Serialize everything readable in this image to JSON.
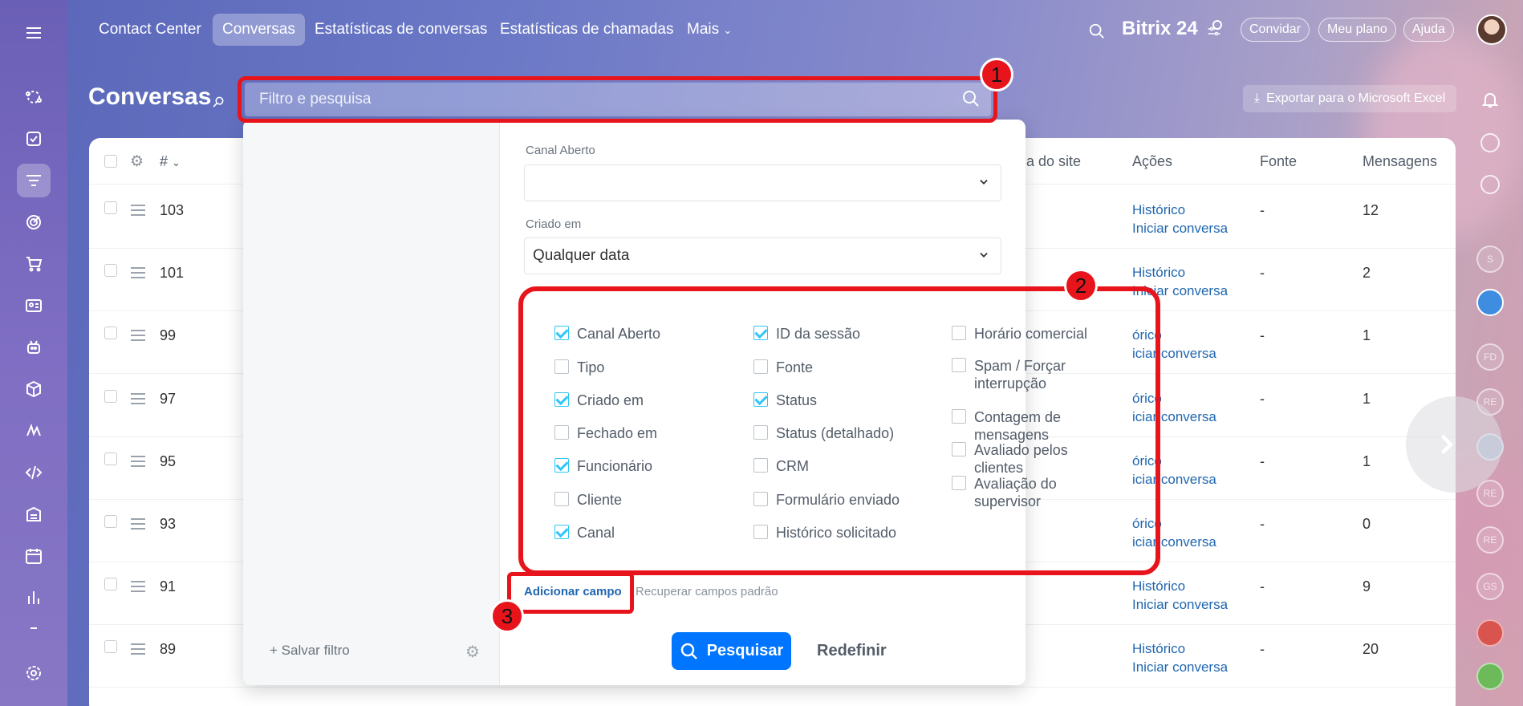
{
  "topbar": {
    "tabs": [
      "Contact Center",
      "Conversas",
      "Estatísticas de conversas",
      "Estatísticas de chamadas",
      "Mais"
    ],
    "brand": "Bitrix 24",
    "invite": "Convidar",
    "plan": "Meu plano",
    "help": "Ajuda"
  },
  "page": {
    "title": "Conversas",
    "export_label": "Exportar para o Microsoft Excel"
  },
  "search": {
    "placeholder": "Filtro e pesquisa"
  },
  "table": {
    "columns": [
      "#",
      "a do site",
      "Ações",
      "Fonte",
      "Mensagens"
    ],
    "rows": [
      {
        "id": "103",
        "actions": [
          "Histórico",
          "Iniciar conversa"
        ],
        "source": "-",
        "messages": "12"
      },
      {
        "id": "101",
        "actions": [
          "Histórico",
          "Iniciar conversa"
        ],
        "source": "-",
        "messages": "2"
      },
      {
        "id": "99",
        "actions": [
          "órico",
          "iciar conversa"
        ],
        "source": "-",
        "messages": "1"
      },
      {
        "id": "97",
        "actions": [
          "órico",
          "iciar conversa"
        ],
        "source": "-",
        "messages": "1"
      },
      {
        "id": "95",
        "actions": [
          "órico",
          "iciar conversa"
        ],
        "source": "-",
        "messages": "1"
      },
      {
        "id": "93",
        "actions": [
          "órico",
          "iciar conversa"
        ],
        "source": "-",
        "messages": "0"
      },
      {
        "id": "91",
        "actions": [
          "Histórico",
          "Iniciar conversa"
        ],
        "source": "-",
        "messages": "9"
      },
      {
        "id": "89",
        "actions": [
          "Histórico",
          "Iniciar conversa"
        ],
        "source": "-",
        "messages": "20"
      }
    ]
  },
  "filter": {
    "channel_label": "Canal Aberto",
    "channel_value": "",
    "created_label": "Criado em",
    "created_value": "Qualquer data",
    "fields_col1": [
      {
        "label": "Canal Aberto",
        "checked": true
      },
      {
        "label": "Tipo",
        "checked": false
      },
      {
        "label": "Criado em",
        "checked": true
      },
      {
        "label": "Fechado em",
        "checked": false
      },
      {
        "label": "Funcionário",
        "checked": true
      },
      {
        "label": "Cliente",
        "checked": false
      },
      {
        "label": "Canal",
        "checked": true
      }
    ],
    "fields_col2": [
      {
        "label": "ID da sessão",
        "checked": true
      },
      {
        "label": "Fonte",
        "checked": false
      },
      {
        "label": "Status",
        "checked": true
      },
      {
        "label": "Status (detalhado)",
        "checked": false
      },
      {
        "label": "CRM",
        "checked": false
      },
      {
        "label": "Formulário enviado",
        "checked": false
      },
      {
        "label": "Histórico solicitado",
        "checked": false
      }
    ],
    "fields_col3": [
      {
        "label": "Horário comercial",
        "checked": false
      },
      {
        "label": "Spam / Forçar interrupção",
        "checked": false
      },
      {
        "label": "Contagem de mensagens",
        "checked": false
      },
      {
        "label": "Avaliado pelos clientes",
        "checked": false
      },
      {
        "label": "Avaliação do supervisor",
        "checked": false
      }
    ],
    "add_field": "Adicionar campo",
    "restore_fields": "Recuperar campos padrão",
    "search_button": "Pesquisar",
    "reset_button": "Redefinir",
    "save_filter": "Salvar filtro"
  },
  "callouts": [
    "1",
    "2",
    "3"
  ],
  "rail_avatars": [
    "S",
    "FD",
    "RE",
    "RE",
    "RE",
    "GS"
  ],
  "colors": {
    "accent": "#0075ff",
    "highlight": "#e8141c",
    "check": "#2fc6f6",
    "link": "#2067b0"
  }
}
